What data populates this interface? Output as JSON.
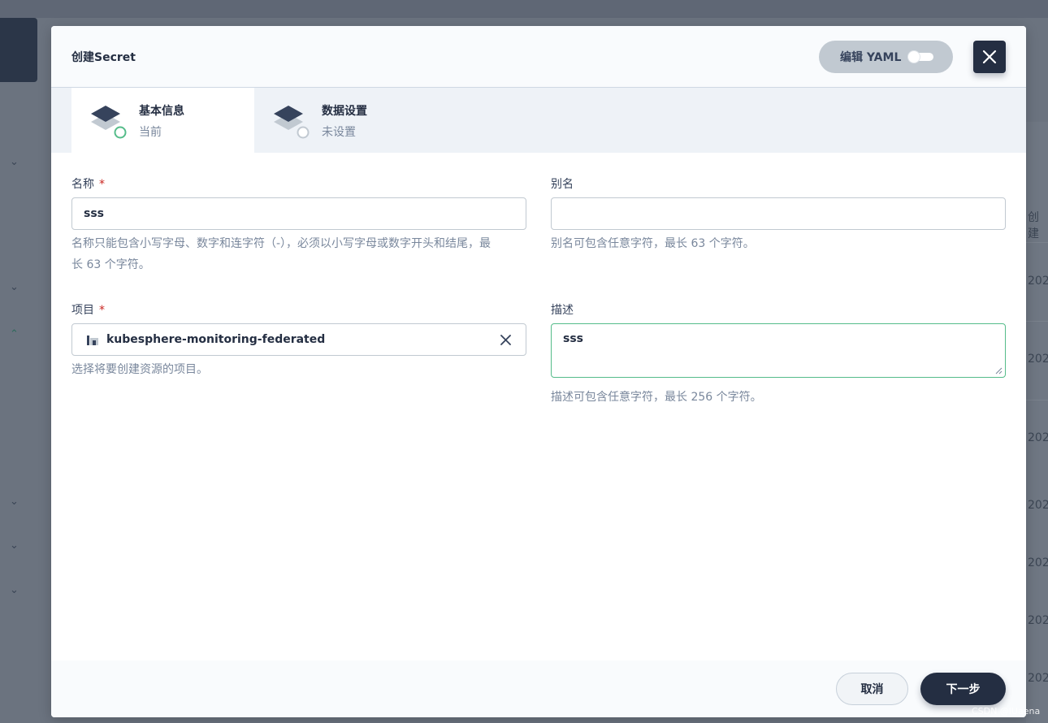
{
  "modal": {
    "title": "创建Secret",
    "yaml_toggle_label": "编辑 YAML"
  },
  "steps": [
    {
      "name": "基本信息",
      "status": "当前"
    },
    {
      "name": "数据设置",
      "status": "未设置"
    }
  ],
  "form": {
    "name": {
      "label": "名称",
      "required_mark": "*",
      "value": "sss",
      "hint_line1": "名称只能包含小写字母、数字和连字符（-），必须以小写字母或数字开头和结尾，最",
      "hint_line2": "长 63 个字符。"
    },
    "alias": {
      "label": "别名",
      "value": "",
      "hint": "别名可包含任意字符，最长 63 个字符。"
    },
    "project": {
      "label": "项目",
      "required_mark": "*",
      "value": "kubesphere-monitoring-federated",
      "hint": "选择将要创建资源的项目。"
    },
    "description": {
      "label": "描述",
      "value": "sss",
      "hint": "描述可包含任意字符，最长 256 个字符。"
    }
  },
  "footer": {
    "cancel_label": "取消",
    "next_label": "下一步"
  },
  "background": {
    "column_header": "创建",
    "row_prefix": "202"
  },
  "watermark": "CSDN @lUaena",
  "colors": {
    "primary_dark": "#242e42",
    "success_green": "#55bc8a",
    "required_red": "#ca2621"
  }
}
